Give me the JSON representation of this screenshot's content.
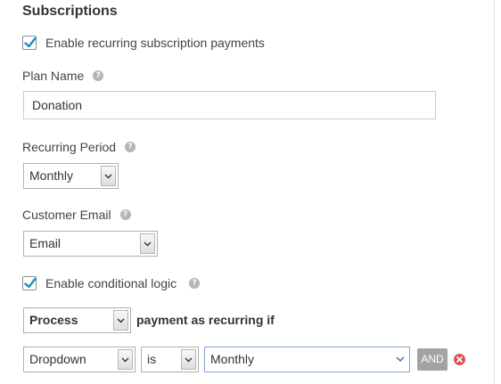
{
  "section": {
    "title": "Subscriptions"
  },
  "recurring": {
    "checkbox_label": "Enable recurring subscription payments",
    "checked": true
  },
  "plan_name": {
    "label": "Plan Name",
    "value": "Donation"
  },
  "recurring_period": {
    "label": "Recurring Period",
    "value": "Monthly"
  },
  "customer_email": {
    "label": "Customer Email",
    "value": "Email"
  },
  "conditional": {
    "checkbox_label": "Enable conditional logic",
    "checked": true,
    "action_value": "Process",
    "action_suffix": "payment as recurring if",
    "rule": {
      "field_value": "Dropdown",
      "operator_value": "is",
      "match_value": "Monthly",
      "and_label": "AND"
    }
  },
  "colors": {
    "checkmark": "#1e8cbe",
    "help_icon": "#b5b5b5",
    "and_button": "#a3a3a3",
    "remove_icon": "#d9534f",
    "focus_border": "#7aa7d6"
  },
  "icons": {
    "help": "question-circle-icon",
    "check": "checkmark-icon",
    "dropdown": "chevron-down-icon",
    "remove": "close-circle-icon"
  }
}
